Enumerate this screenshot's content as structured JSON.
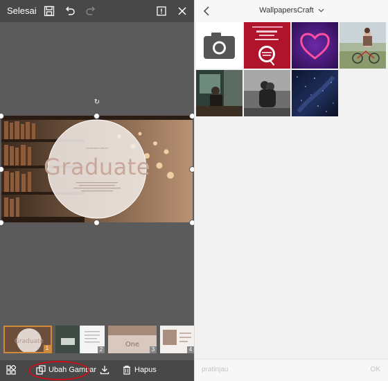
{
  "editor": {
    "toolbar": {
      "done_label": "Selesai",
      "icons": [
        "save-icon",
        "undo-icon",
        "redo-icon",
        "info-icon",
        "close-icon"
      ]
    },
    "canvas": {
      "title": "Graduate",
      "subtitle": "Graduation Album"
    },
    "pages": [
      {
        "number": "1",
        "label": "Graduate",
        "selected": true
      },
      {
        "number": "2",
        "selected": false
      },
      {
        "number": "3",
        "label": "One",
        "selected": false
      },
      {
        "number": "4",
        "selected": false
      }
    ],
    "bottom_bar": {
      "change_image_label": "Ubah Gambar",
      "delete_label": "Hapus",
      "icons": [
        "grid-icon",
        "replace-image-icon",
        "download-icon",
        "trash-icon"
      ]
    }
  },
  "gallery": {
    "title": "WallpapersCraft",
    "preview_label": "pratinjau",
    "ok_label": "OK",
    "icons": [
      "back-icon",
      "chevron-down-icon",
      "camera-icon"
    ],
    "accent_ring_color": "#d0101a"
  }
}
